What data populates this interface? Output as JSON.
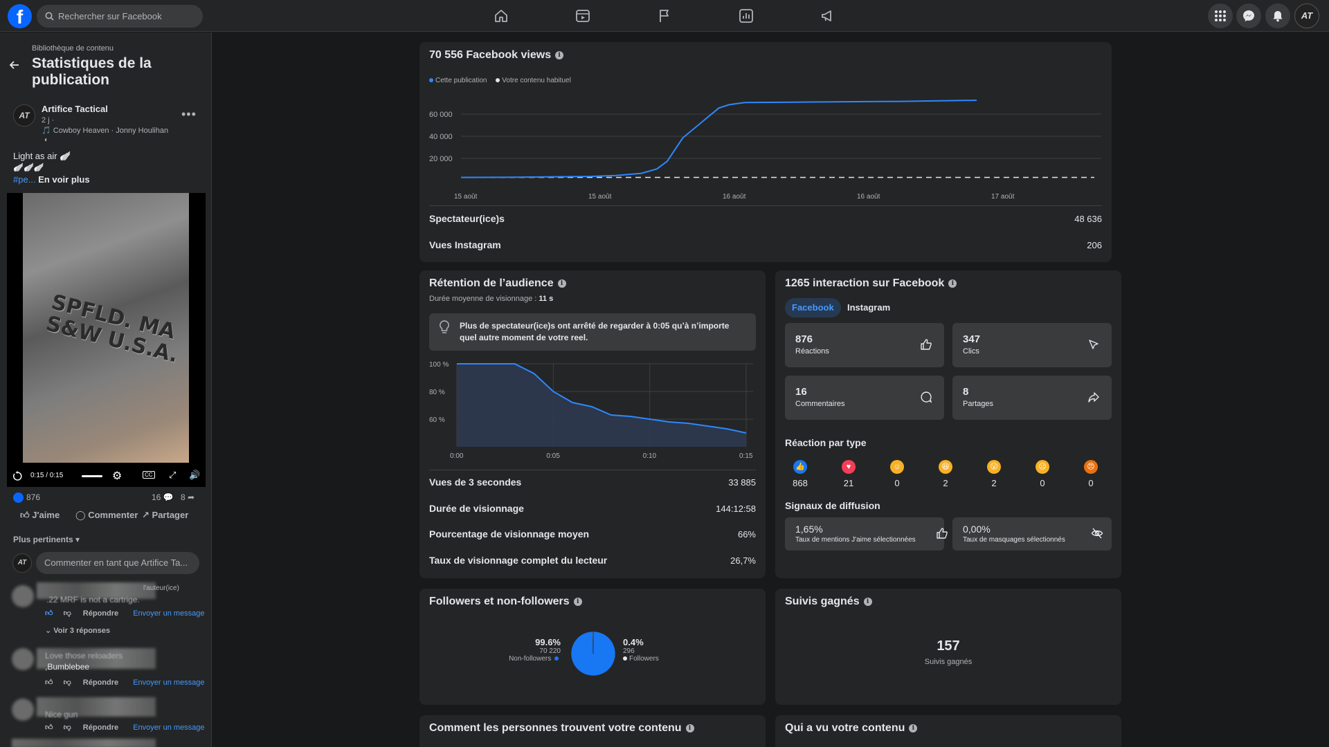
{
  "topbar": {
    "logo": "f",
    "search_placeholder": "Rechercher sur Facebook",
    "avatar_initials": "AT"
  },
  "sidebar": {
    "breadcrumb": "Bibliothèque de contenu",
    "title": "Statistiques de la publication",
    "post": {
      "avatar": "AT",
      "author": "Artifice Tactical",
      "time": "2 j ·",
      "music": "🎵 Cowboy Heaven · Jonny Houlihan",
      "caption_line1": "Light as air 🪽",
      "caption_line2": "🪽🪽🪽",
      "hashtag": "#pe...",
      "see_more": "En voir plus",
      "video_engraving_1": "SPFLD. MA",
      "video_engraving_2": "S&W U.S.A.",
      "video_time": "0:15 / 0:15",
      "reaction_count": "876",
      "comment_count": "16",
      "share_count": "8",
      "like_label": "J'aime",
      "comment_label": "Commenter",
      "share_label": "Partager"
    },
    "sort_label": "Plus pertinents",
    "comment_placeholder": "Commenter en tant que Artifice Ta...",
    "comments": [
      {
        "badge": "l'auteur(ice)",
        "text": ".22 MRF is not a cartrige.",
        "reply": "Répondre",
        "message": "Envoyer un message",
        "replies_link": "Voir 3 réponses"
      },
      {
        "text": "Love those reloaders",
        "text2": ",Bumblebee",
        "reply": "Répondre",
        "message": "Envoyer un message"
      },
      {
        "text": "Nice gun",
        "reply": "Répondre",
        "message": "Envoyer un message"
      }
    ]
  },
  "views_card": {
    "title": "70 556 Facebook views",
    "legend_this": "Cette publication",
    "legend_usual": "Votre contenu habituel",
    "colors": {
      "this": "#2d88ff",
      "usual": "#e4e6eb"
    },
    "rows": [
      {
        "label": "Spectateur(ice)s",
        "value": "48 636"
      },
      {
        "label": "Vues Instagram",
        "value": "206"
      }
    ]
  },
  "retention_card": {
    "title": "Rétention de l’audience",
    "subtitle_label": "Durée moyenne de visionnage :",
    "subtitle_value": "11 s",
    "tip": "Plus de spectateur(ice)s ont arrêté de regarder à 0:05 qu’à n’importe quel autre moment de votre reel.",
    "rows": [
      {
        "label": "Vues de 3 secondes",
        "value": "33 885"
      },
      {
        "label": "Durée de visionnage",
        "value": "144:12:58"
      },
      {
        "label": "Pourcentage de visionnage moyen",
        "value": "66%"
      },
      {
        "label": "Taux de visionnage complet du lecteur",
        "value": "26,7%"
      }
    ]
  },
  "interaction_card": {
    "title": "1265 interaction sur Facebook",
    "tabs": [
      "Facebook",
      "Instagram"
    ],
    "tiles": [
      {
        "value": "876",
        "label": "Réactions",
        "icon": "thumb-up-icon"
      },
      {
        "value": "347",
        "label": "Clics",
        "icon": "cursor-icon"
      },
      {
        "value": "16",
        "label": "Commentaires",
        "icon": "comment-icon"
      },
      {
        "value": "8",
        "label": "Partages",
        "icon": "share-icon"
      }
    ],
    "reactions_title": "Réaction par type",
    "reactions": [
      {
        "name": "like",
        "count": "868",
        "color": "#1877f2"
      },
      {
        "name": "love",
        "count": "21",
        "color": "#f33e58"
      },
      {
        "name": "care",
        "count": "0",
        "color": "#f7b125"
      },
      {
        "name": "haha",
        "count": "2",
        "color": "#f7b125"
      },
      {
        "name": "wow",
        "count": "2",
        "color": "#f7b125"
      },
      {
        "name": "sad",
        "count": "0",
        "color": "#f7b125"
      },
      {
        "name": "angry",
        "count": "0",
        "color": "#e9710f"
      }
    ],
    "signals_title": "Signaux de diffusion",
    "signals": [
      {
        "value": "1,65%",
        "label": "Taux de mentions J'aime sélectionnées",
        "icon": "thumb-up-icon"
      },
      {
        "value": "0,00%",
        "label": "Taux de masquages sélectionnés",
        "icon": "eye-off-icon"
      }
    ]
  },
  "followers_card": {
    "title": "Followers et non-followers",
    "non_followers_pct": "99.6%",
    "non_followers_count": "70 220",
    "non_followers_label": "Non-followers",
    "followers_pct": "0.4%",
    "followers_count": "296",
    "followers_label": "Followers"
  },
  "follows_card": {
    "title": "Suivis gagnés",
    "value": "157",
    "label": "Suivis gagnés"
  },
  "bottom_cards": {
    "discover_title": "Comment les personnes trouvent votre contenu",
    "audience_title": "Qui a vu votre contenu"
  },
  "chart_data": [
    {
      "type": "line",
      "title": "",
      "x": [
        "15 août",
        "15 août",
        "16 août",
        "16 août",
        "17 août"
      ],
      "yticks": [
        "20 000",
        "40 000",
        "60 000"
      ],
      "ylim": [
        0,
        75000
      ],
      "series": [
        {
          "name": "Cette publication",
          "points": [
            [
              0,
              300
            ],
            [
              0.05,
              400
            ],
            [
              0.1,
              500
            ],
            [
              0.15,
              700
            ],
            [
              0.2,
              900
            ],
            [
              0.25,
              1200
            ],
            [
              0.3,
              2000
            ],
            [
              0.35,
              4000
            ],
            [
              0.38,
              8000
            ],
            [
              0.4,
              15000
            ],
            [
              0.43,
              36000
            ],
            [
              0.5,
              63000
            ],
            [
              0.52,
              66000
            ],
            [
              0.55,
              68000
            ],
            [
              0.7,
              68500
            ],
            [
              0.85,
              69000
            ],
            [
              1.0,
              70000
            ]
          ]
        },
        {
          "name": "Votre contenu habituel",
          "points": [
            [
              0,
              300
            ],
            [
              1.0,
              300
            ]
          ]
        }
      ],
      "grid": true,
      "legend": "top-left"
    },
    {
      "type": "area",
      "title": "",
      "x": [
        "0:00",
        "0:05",
        "0:10",
        "0:15"
      ],
      "yticks": [
        "60 %",
        "80 %",
        "100 %"
      ],
      "ylim": [
        40,
        100
      ],
      "series": [
        {
          "name": "",
          "points": [
            [
              0,
              100
            ],
            [
              1,
              100
            ],
            [
              2,
              100
            ],
            [
              3,
              100
            ],
            [
              4,
              93
            ],
            [
              5,
              80
            ],
            [
              6,
              72
            ],
            [
              7,
              69
            ],
            [
              8,
              63
            ],
            [
              9,
              62
            ],
            [
              10,
              60
            ],
            [
              11,
              58
            ],
            [
              12,
              57
            ],
            [
              13,
              55
            ],
            [
              14,
              53
            ],
            [
              15,
              50
            ]
          ]
        }
      ],
      "xmax": 15,
      "grid": true
    },
    {
      "type": "pie",
      "title": "",
      "slices": [
        {
          "label": "Non-followers",
          "value": 99.6,
          "color": "#1877f2"
        },
        {
          "label": "Followers",
          "value": 0.4,
          "color": "#e4e6eb"
        }
      ]
    }
  ]
}
